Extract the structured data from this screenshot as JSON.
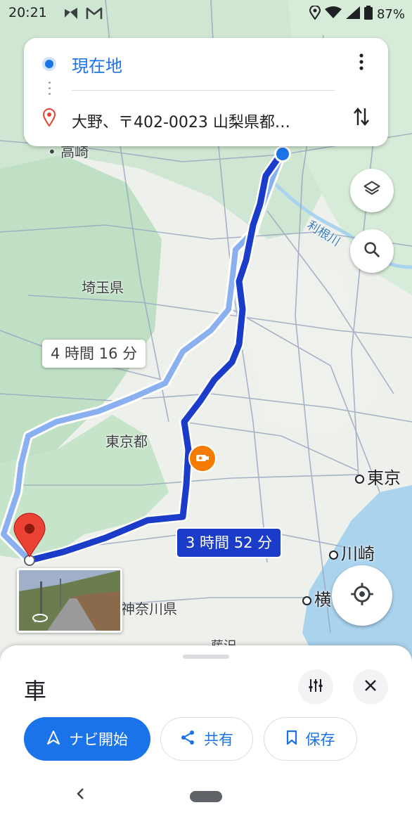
{
  "status": {
    "time": "20:21",
    "battery": "87%"
  },
  "search": {
    "origin": "現在地",
    "destination": "大野、〒402-0023 山梨県都…"
  },
  "map": {
    "labels": {
      "takasaki": "高崎",
      "tonegawa": "利根川",
      "saitama": "埼玉県",
      "tokyo_to": "東京都",
      "tokyo": "東京",
      "kawasaki": "川崎",
      "yoko": "横",
      "kanagawa": "神奈川県",
      "fujisawa": "藤沢"
    },
    "routes": {
      "alternative_duration": "4 時間 16 分",
      "main_duration": "3 時間 52 分"
    }
  },
  "sheet": {
    "mode": "車",
    "buttons": {
      "start": "ナビ開始",
      "share": "共有",
      "save": "保存"
    }
  },
  "colors": {
    "primary": "#1a73e8",
    "route_main": "#1a3cc8",
    "route_alt": "#8ab0f0",
    "pin": "#ea4335",
    "camera": "#f57c00"
  },
  "icons": {
    "more": "more-vert-icon",
    "swap": "swap-vert-icon",
    "layers": "layers-icon",
    "search": "search-icon",
    "locate": "my-location-icon",
    "filter": "tune-icon",
    "close": "close-icon",
    "navigate": "navigation-arrow-icon",
    "share": "share-icon",
    "save": "bookmark-icon"
  }
}
